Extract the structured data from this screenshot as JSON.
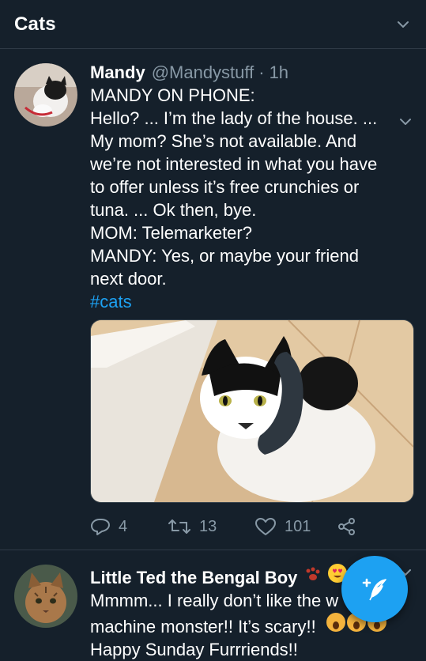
{
  "header": {
    "title": "Cats"
  },
  "tweets": [
    {
      "name": "Mandy",
      "handle": "@Mandystuff",
      "dot": "·",
      "time": "1h",
      "lines": [
        "MANDY ON PHONE:",
        "Hello? ... I’m the lady of the house.  ...",
        "My mom?  She’s not available.  And",
        "we’re not interested in what you have",
        "to offer unless it’s free crunchies or",
        "tuna.  ...  Ok then, bye.",
        "MOM:  Telemarketer?",
        "MANDY:  Yes, or maybe your friend",
        "next door."
      ],
      "hashtag": "#cats",
      "replies": "4",
      "retweets": "13",
      "likes": "101"
    },
    {
      "name": "Little Ted the Bengal Boy",
      "lines": [
        "Mmmm... I really don’t like the w",
        "machine monster!! It’s scary!!",
        "Happy Sunday Furrriends!!"
      ]
    }
  ],
  "colors": {
    "background": "#15202b",
    "accent": "#1da1f2",
    "muted": "#8899a6",
    "divider": "#2f3b47"
  }
}
